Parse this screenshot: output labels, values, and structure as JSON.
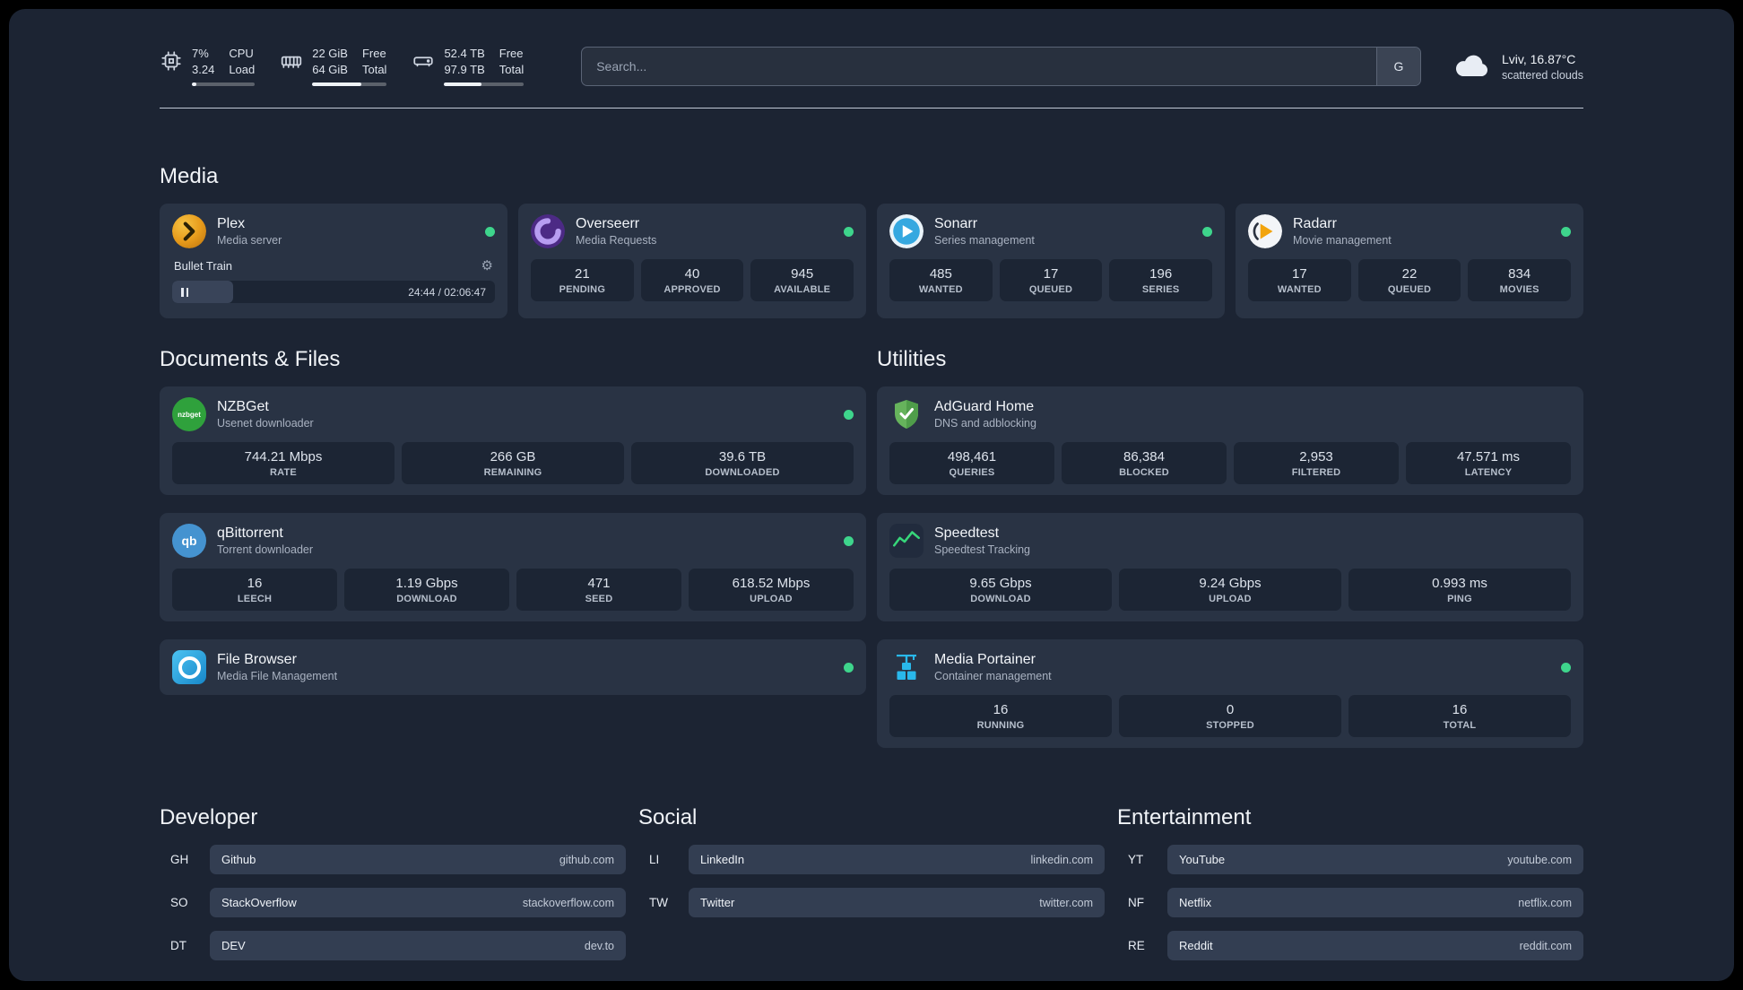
{
  "colors": {
    "background": "#1c2433",
    "card": "#293344",
    "status_online": "#3ed58c",
    "accent_green": "#37d67a"
  },
  "topbar": {
    "cpu": {
      "rows": [
        [
          "7%",
          "CPU"
        ],
        [
          "3.24",
          "Load"
        ]
      ],
      "percent": 7
    },
    "memory": {
      "rows": [
        [
          "22 GiB",
          "Free"
        ],
        [
          "64 GiB",
          "Total"
        ]
      ],
      "percent": 66
    },
    "disk": {
      "rows": [
        [
          "52.4 TB",
          "Free"
        ],
        [
          "97.9 TB",
          "Total"
        ]
      ],
      "percent": 47
    },
    "search": {
      "placeholder": "Search...",
      "provider_label": "G"
    },
    "weather": {
      "location": "Lviv, 16.87°C",
      "condition": "scattered clouds"
    }
  },
  "sections": {
    "media": "Media",
    "documents": "Documents & Files",
    "utilities": "Utilities",
    "developer": "Developer",
    "social": "Social",
    "entertainment": "Entertainment"
  },
  "apps": {
    "plex": {
      "title": "Plex",
      "subtitle": "Media server",
      "online": true,
      "player": {
        "track": "Bullet Train",
        "time": "24:44 / 02:06:47",
        "progress": 19
      }
    },
    "overseerr": {
      "title": "Overseerr",
      "subtitle": "Media Requests",
      "online": true,
      "stats": [
        {
          "value": "21",
          "label": "PENDING"
        },
        {
          "value": "40",
          "label": "APPROVED"
        },
        {
          "value": "945",
          "label": "AVAILABLE"
        }
      ]
    },
    "sonarr": {
      "title": "Sonarr",
      "subtitle": "Series management",
      "online": true,
      "stats": [
        {
          "value": "485",
          "label": "WANTED"
        },
        {
          "value": "17",
          "label": "QUEUED"
        },
        {
          "value": "196",
          "label": "SERIES"
        }
      ]
    },
    "radarr": {
      "title": "Radarr",
      "subtitle": "Movie management",
      "online": true,
      "stats": [
        {
          "value": "17",
          "label": "WANTED"
        },
        {
          "value": "22",
          "label": "QUEUED"
        },
        {
          "value": "834",
          "label": "MOVIES"
        }
      ]
    },
    "nzbget": {
      "title": "NZBGet",
      "subtitle": "Usenet downloader",
      "online": true,
      "icon_text": "nzbget",
      "stats": [
        {
          "value": "744.21 Mbps",
          "label": "RATE"
        },
        {
          "value": "266 GB",
          "label": "REMAINING"
        },
        {
          "value": "39.6 TB",
          "label": "DOWNLOADED"
        }
      ]
    },
    "qbittorrent": {
      "title": "qBittorrent",
      "subtitle": "Torrent downloader",
      "online": true,
      "icon_text": "qb",
      "stats": [
        {
          "value": "16",
          "label": "LEECH"
        },
        {
          "value": "1.19 Gbps",
          "label": "DOWNLOAD"
        },
        {
          "value": "471",
          "label": "SEED"
        },
        {
          "value": "618.52 Mbps",
          "label": "UPLOAD"
        }
      ]
    },
    "filebrowser": {
      "title": "File Browser",
      "subtitle": "Media File Management",
      "online": true
    },
    "adguard": {
      "title": "AdGuard Home",
      "subtitle": "DNS and adblocking",
      "online": false,
      "stats": [
        {
          "value": "498,461",
          "label": "QUERIES"
        },
        {
          "value": "86,384",
          "label": "BLOCKED"
        },
        {
          "value": "2,953",
          "label": "FILTERED"
        },
        {
          "value": "47.571 ms",
          "label": "LATENCY"
        }
      ]
    },
    "speedtest": {
      "title": "Speedtest",
      "subtitle": "Speedtest Tracking",
      "online": false,
      "stats": [
        {
          "value": "9.65 Gbps",
          "label": "DOWNLOAD"
        },
        {
          "value": "9.24 Gbps",
          "label": "UPLOAD"
        },
        {
          "value": "0.993 ms",
          "label": "PING"
        }
      ]
    },
    "portainer": {
      "title": "Media Portainer",
      "subtitle": "Container management",
      "online": true,
      "stats": [
        {
          "value": "16",
          "label": "RUNNING"
        },
        {
          "value": "0",
          "label": "STOPPED"
        },
        {
          "value": "16",
          "label": "TOTAL"
        }
      ]
    }
  },
  "bookmarks": {
    "developer": [
      {
        "abbr": "GH",
        "name": "Github",
        "url": "github.com"
      },
      {
        "abbr": "SO",
        "name": "StackOverflow",
        "url": "stackoverflow.com"
      },
      {
        "abbr": "DT",
        "name": "DEV",
        "url": "dev.to"
      }
    ],
    "social": [
      {
        "abbr": "LI",
        "name": "LinkedIn",
        "url": "linkedin.com"
      },
      {
        "abbr": "TW",
        "name": "Twitter",
        "url": "twitter.com"
      }
    ],
    "entertainment": [
      {
        "abbr": "YT",
        "name": "YouTube",
        "url": "youtube.com"
      },
      {
        "abbr": "NF",
        "name": "Netflix",
        "url": "netflix.com"
      },
      {
        "abbr": "RE",
        "name": "Reddit",
        "url": "reddit.com"
      }
    ]
  }
}
